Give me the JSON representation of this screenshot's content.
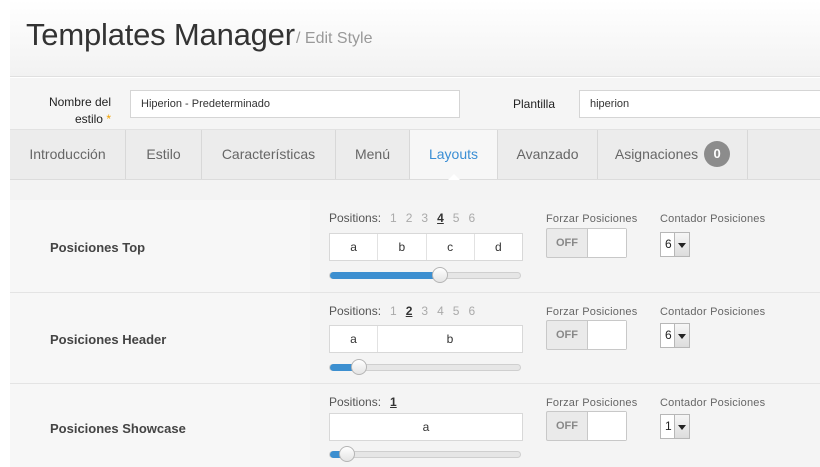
{
  "header": {
    "title": "Templates Manager",
    "subtitle": "/ Edit Style"
  },
  "fields": {
    "style_name_label_line1": "Nombre del",
    "style_name_label_line2": "estilo",
    "required_mark": "*",
    "style_name_value": "Hiperion - Predeterminado",
    "template_label": "Plantilla",
    "template_value": "hiperion"
  },
  "tabs": [
    {
      "label": "Introducción"
    },
    {
      "label": "Estilo"
    },
    {
      "label": "Características"
    },
    {
      "label": "Menú"
    },
    {
      "label": "Layouts",
      "active": true
    },
    {
      "label": "Avanzado"
    },
    {
      "label": "Asignaciones",
      "badge": "0"
    }
  ],
  "common": {
    "positions_label": "Positions:",
    "force_label": "Forzar Posiciones",
    "counter_label": "Contador Posiciones",
    "toggle_state": "OFF"
  },
  "rows": [
    {
      "label": "Posiciones Top",
      "position_options": [
        "1",
        "2",
        "3",
        "4",
        "5",
        "6"
      ],
      "selected_positions": "4",
      "boxes": [
        "a",
        "b",
        "c",
        "d"
      ],
      "slider_fraction": 0.58,
      "counter_value": "6"
    },
    {
      "label": "Posiciones Header",
      "position_options": [
        "1",
        "2",
        "3",
        "4",
        "5",
        "6"
      ],
      "selected_positions": "2",
      "boxes": [
        "a",
        "b"
      ],
      "slider_fraction": 0.15,
      "counter_value": "6"
    },
    {
      "label": "Posiciones Showcase",
      "position_options": [
        "1"
      ],
      "selected_positions": "1",
      "boxes": [
        "a"
      ],
      "slider_fraction": 0.09,
      "counter_value": "1"
    }
  ],
  "colors": {
    "accent": "#3a8ed4",
    "slider_fill": "#3c8fd0",
    "required": "#f0a000",
    "badge": "#8c8c8c"
  }
}
